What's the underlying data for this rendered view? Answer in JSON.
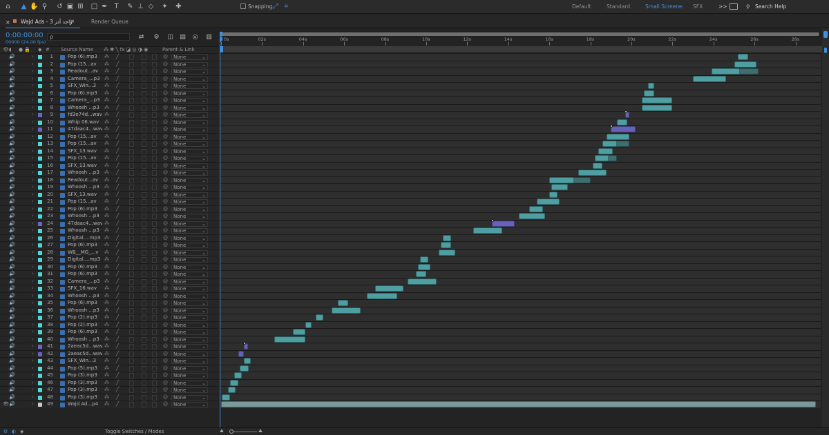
{
  "toolbar": {
    "workspaces": [
      "Default",
      "Standard",
      "Small Screen",
      "SFX"
    ],
    "active_workspace": "Small Screen",
    "snapping_label": "Snapping",
    "search_placeholder": "Search Help",
    "more_label": ">>"
  },
  "panel": {
    "comp_tab_label": "Wajd Ads - 3 واجد أدز",
    "render_queue_label": "Render Queue",
    "timecode": "0:00:00:00",
    "frame_info": "00000 (24.00 fps)",
    "search_icon_glyph": "ρ"
  },
  "columns": {
    "hash": "#",
    "source_name": "Source Name",
    "parent_link": "Parent & Link"
  },
  "ruler": {
    "ticks": [
      "0s",
      "02s",
      "04s",
      "06s",
      "08s",
      "10s",
      "12s",
      "14s",
      "16s",
      "18s",
      "20s",
      "22s",
      "24s",
      "26s",
      "28s"
    ]
  },
  "layers": [
    {
      "num": "1",
      "name": "Pop (6).mp3",
      "parent": "None",
      "color": "#4fd6d6"
    },
    {
      "num": "2",
      "name": "Pop (15...av",
      "parent": "None",
      "color": "#4fd6d6"
    },
    {
      "num": "3",
      "name": "Readout...av",
      "parent": "None",
      "color": "#4fd6d6"
    },
    {
      "num": "4",
      "name": "Camera_...p3",
      "parent": "None",
      "color": "#4fd6d6"
    },
    {
      "num": "5",
      "name": "SFX_Win...3",
      "parent": "None",
      "color": "#4fd6d6"
    },
    {
      "num": "6",
      "name": "Pop (6).mp3",
      "parent": "None",
      "color": "#4fd6d6"
    },
    {
      "num": "7",
      "name": "Camera_...p3",
      "parent": "None",
      "color": "#4fd6d6"
    },
    {
      "num": "8",
      "name": "Whoosh ...p3",
      "parent": "None",
      "color": "#4fd6d6"
    },
    {
      "num": "9",
      "name": "fd3e74d...wav",
      "parent": "None",
      "color": "#6a66c8"
    },
    {
      "num": "10",
      "name": "Whip 06.wav",
      "parent": "None",
      "color": "#4fd6d6"
    },
    {
      "num": "11",
      "name": "47daac4...wav",
      "parent": "None",
      "color": "#6a66c8"
    },
    {
      "num": "12",
      "name": "Pop (15...av",
      "parent": "None",
      "color": "#4fd6d6"
    },
    {
      "num": "13",
      "name": "Pop (15...av",
      "parent": "None",
      "color": "#4fd6d6"
    },
    {
      "num": "14",
      "name": "SFX_13.wav",
      "parent": "None",
      "color": "#4fd6d6"
    },
    {
      "num": "15",
      "name": "Pop (15...av",
      "parent": "None",
      "color": "#4fd6d6"
    },
    {
      "num": "16",
      "name": "SFX_13.wav",
      "parent": "None",
      "color": "#4fd6d6"
    },
    {
      "num": "17",
      "name": "Whoosh ...p3",
      "parent": "None",
      "color": "#4fd6d6"
    },
    {
      "num": "18",
      "name": "Readout...av",
      "parent": "None",
      "color": "#4fd6d6"
    },
    {
      "num": "19",
      "name": "Whoosh ...p3",
      "parent": "None",
      "color": "#4fd6d6"
    },
    {
      "num": "20",
      "name": "SFX_13.wav",
      "parent": "None",
      "color": "#4fd6d6"
    },
    {
      "num": "21",
      "name": "Pop (15...av",
      "parent": "None",
      "color": "#4fd6d6"
    },
    {
      "num": "22",
      "name": "Pop (6).mp3",
      "parent": "None",
      "color": "#4fd6d6"
    },
    {
      "num": "23",
      "name": "Whoosh ...p3",
      "parent": "None",
      "color": "#4fd6d6"
    },
    {
      "num": "24",
      "name": "47daac4...wav",
      "parent": "None",
      "color": "#6a66c8"
    },
    {
      "num": "25",
      "name": "Whoosh ...p3",
      "parent": "None",
      "color": "#4fd6d6"
    },
    {
      "num": "26",
      "name": "Digital....mp3",
      "parent": "None",
      "color": "#4fd6d6"
    },
    {
      "num": "27",
      "name": "Pop (6).mp3",
      "parent": "None",
      "color": "#4fd6d6"
    },
    {
      "num": "28",
      "name": "WB__MG_...v",
      "parent": "None",
      "color": "#4fd6d6"
    },
    {
      "num": "29",
      "name": "Digital....mp3",
      "parent": "None",
      "color": "#4fd6d6"
    },
    {
      "num": "30",
      "name": "Pop (6).mp3",
      "parent": "None",
      "color": "#4fd6d6"
    },
    {
      "num": "31",
      "name": "Pop (6).mp3",
      "parent": "None",
      "color": "#4fd6d6"
    },
    {
      "num": "32",
      "name": "Camera_...p3",
      "parent": "None",
      "color": "#4fd6d6"
    },
    {
      "num": "33",
      "name": "SFX_16.wav",
      "parent": "None",
      "color": "#4fd6d6"
    },
    {
      "num": "34",
      "name": "Whoosh ...p3",
      "parent": "None",
      "color": "#4fd6d6"
    },
    {
      "num": "35",
      "name": "Pop (6).mp3",
      "parent": "None",
      "color": "#4fd6d6"
    },
    {
      "num": "36",
      "name": "Whoosh ...p3",
      "parent": "None",
      "color": "#4fd6d6"
    },
    {
      "num": "37",
      "name": "Pop (2).mp3",
      "parent": "None",
      "color": "#4fd6d6"
    },
    {
      "num": "38",
      "name": "Pop (2).mp3",
      "parent": "None",
      "color": "#4fd6d6"
    },
    {
      "num": "39",
      "name": "Pop (6).mp3",
      "parent": "None",
      "color": "#4fd6d6"
    },
    {
      "num": "40",
      "name": "Whoosh ...p3",
      "parent": "None",
      "color": "#4fd6d6"
    },
    {
      "num": "41",
      "name": "2aeac5d...wav",
      "parent": "None",
      "color": "#6a66c8"
    },
    {
      "num": "42",
      "name": "2aeac5d...wav",
      "parent": "None",
      "color": "#6a66c8"
    },
    {
      "num": "43",
      "name": "SFX_Win...3",
      "parent": "None",
      "color": "#4fd6d6"
    },
    {
      "num": "44",
      "name": "Pop (5).mp3",
      "parent": "None",
      "color": "#4fd6d6"
    },
    {
      "num": "45",
      "name": "Pop (3).mp3",
      "parent": "None",
      "color": "#4fd6d6"
    },
    {
      "num": "46",
      "name": "Pop (3).mp3",
      "parent": "None",
      "color": "#4fd6d6"
    },
    {
      "num": "47",
      "name": "Pop (3).mp3",
      "parent": "None",
      "color": "#4fd6d6"
    },
    {
      "num": "48",
      "name": "Pop (3).mp3",
      "parent": "None",
      "color": "#4fd6d6"
    },
    {
      "num": "49",
      "name": "Wajd Ad...p4",
      "parent": "None",
      "color": "#c8c8c8"
    }
  ],
  "clips": [
    {
      "layer": 1,
      "start": 25.2,
      "end": 25.7,
      "color": "#4e9ea2"
    },
    {
      "layer": 2,
      "start": 25.0,
      "end": 26.1,
      "color": "#4e9ea2"
    },
    {
      "layer": 3,
      "start": 23.9,
      "end": 25.3,
      "color": "#4e9ea2",
      "tail": 26.2
    },
    {
      "layer": 4,
      "start": 23.0,
      "end": 24.6,
      "color": "#4e9ea2"
    },
    {
      "layer": 5,
      "start": 20.8,
      "end": 21.1,
      "color": "#4e9ea2"
    },
    {
      "layer": 6,
      "start": 20.6,
      "end": 21.1,
      "color": "#4e9ea2"
    },
    {
      "layer": 7,
      "start": 20.5,
      "end": 22.0,
      "color": "#4e9ea2"
    },
    {
      "layer": 8,
      "start": 20.5,
      "end": 22.0,
      "color": "#4e9ea2"
    },
    {
      "layer": 9,
      "start": 19.7,
      "end": 19.9,
      "color": "#6662b8",
      "cap": true
    },
    {
      "layer": 10,
      "start": 19.3,
      "end": 19.8,
      "color": "#4e9ea2"
    },
    {
      "layer": 11,
      "start": 19.0,
      "end": 20.2,
      "color": "#6662b8",
      "cap": true
    },
    {
      "layer": 12,
      "start": 18.8,
      "end": 19.9,
      "color": "#4e9ea2"
    },
    {
      "layer": 13,
      "start": 18.6,
      "end": 19.3,
      "color": "#4e9ea2",
      "tail": 19.9
    },
    {
      "layer": 14,
      "start": 18.4,
      "end": 19.1,
      "color": "#4e9ea2"
    },
    {
      "layer": 15,
      "start": 18.2,
      "end": 18.9,
      "color": "#4e9ea2",
      "tail": 19.3
    },
    {
      "layer": 16,
      "start": 18.1,
      "end": 18.6,
      "color": "#4e9ea2"
    },
    {
      "layer": 17,
      "start": 17.4,
      "end": 18.8,
      "color": "#4e9ea2"
    },
    {
      "layer": 18,
      "start": 16.0,
      "end": 17.2,
      "color": "#4e9ea2",
      "tail": 18.0
    },
    {
      "layer": 19,
      "start": 16.1,
      "end": 16.9,
      "color": "#4e9ea2"
    },
    {
      "layer": 20,
      "start": 16.0,
      "end": 16.4,
      "color": "#4e9ea2"
    },
    {
      "layer": 21,
      "start": 15.4,
      "end": 16.5,
      "color": "#4e9ea2"
    },
    {
      "layer": 22,
      "start": 15.0,
      "end": 15.7,
      "color": "#4e9ea2"
    },
    {
      "layer": 23,
      "start": 14.5,
      "end": 15.8,
      "color": "#4e9ea2"
    },
    {
      "layer": 24,
      "start": 13.2,
      "end": 14.3,
      "color": "#6662b8",
      "cap": true
    },
    {
      "layer": 25,
      "start": 12.3,
      "end": 13.7,
      "color": "#4e9ea2"
    },
    {
      "layer": 26,
      "start": 10.8,
      "end": 11.2,
      "color": "#4e9ea2"
    },
    {
      "layer": 27,
      "start": 10.7,
      "end": 11.2,
      "color": "#4e9ea2"
    },
    {
      "layer": 28,
      "start": 10.6,
      "end": 11.4,
      "color": "#4e9ea2"
    },
    {
      "layer": 29,
      "start": 9.7,
      "end": 10.1,
      "color": "#4e9ea2"
    },
    {
      "layer": 30,
      "start": 9.6,
      "end": 10.2,
      "color": "#4e9ea2"
    },
    {
      "layer": 31,
      "start": 9.5,
      "end": 10.0,
      "color": "#4e9ea2"
    },
    {
      "layer": 32,
      "start": 9.1,
      "end": 10.5,
      "color": "#4e9ea2"
    },
    {
      "layer": 33,
      "start": 7.5,
      "end": 8.9,
      "color": "#4e9ea2"
    },
    {
      "layer": 34,
      "start": 7.1,
      "end": 8.6,
      "color": "#4e9ea2"
    },
    {
      "layer": 35,
      "start": 5.7,
      "end": 6.2,
      "color": "#4e9ea2"
    },
    {
      "layer": 36,
      "start": 5.4,
      "end": 6.8,
      "color": "#4e9ea2"
    },
    {
      "layer": 37,
      "start": 4.6,
      "end": 5.0,
      "color": "#4e9ea2"
    },
    {
      "layer": 38,
      "start": 4.1,
      "end": 4.4,
      "color": "#4e9ea2"
    },
    {
      "layer": 39,
      "start": 3.5,
      "end": 4.1,
      "color": "#4e9ea2"
    },
    {
      "layer": 40,
      "start": 2.6,
      "end": 4.1,
      "color": "#4e9ea2"
    },
    {
      "layer": 41,
      "start": 1.1,
      "end": 1.3,
      "color": "#6662b8",
      "cap": true
    },
    {
      "layer": 42,
      "start": 0.85,
      "end": 1.1,
      "color": "#6662b8"
    },
    {
      "layer": 43,
      "start": 1.1,
      "end": 1.45,
      "color": "#4e9ea2"
    },
    {
      "layer": 44,
      "start": 0.9,
      "end": 1.35,
      "color": "#4e9ea2"
    },
    {
      "layer": 45,
      "start": 0.65,
      "end": 1.0,
      "color": "#4e9ea2"
    },
    {
      "layer": 46,
      "start": 0.45,
      "end": 0.85,
      "color": "#4e9ea2"
    },
    {
      "layer": 47,
      "start": 0.35,
      "end": 0.7,
      "color": "#4e9ea2"
    },
    {
      "layer": 48,
      "start": 0.05,
      "end": 0.45,
      "color": "#4e9ea2"
    },
    {
      "layer": 49,
      "start": 0.0,
      "end": 29.0,
      "color": "#7a9a9a"
    }
  ],
  "statusbar": {
    "toggle_label": "Toggle Switches / Modes"
  }
}
